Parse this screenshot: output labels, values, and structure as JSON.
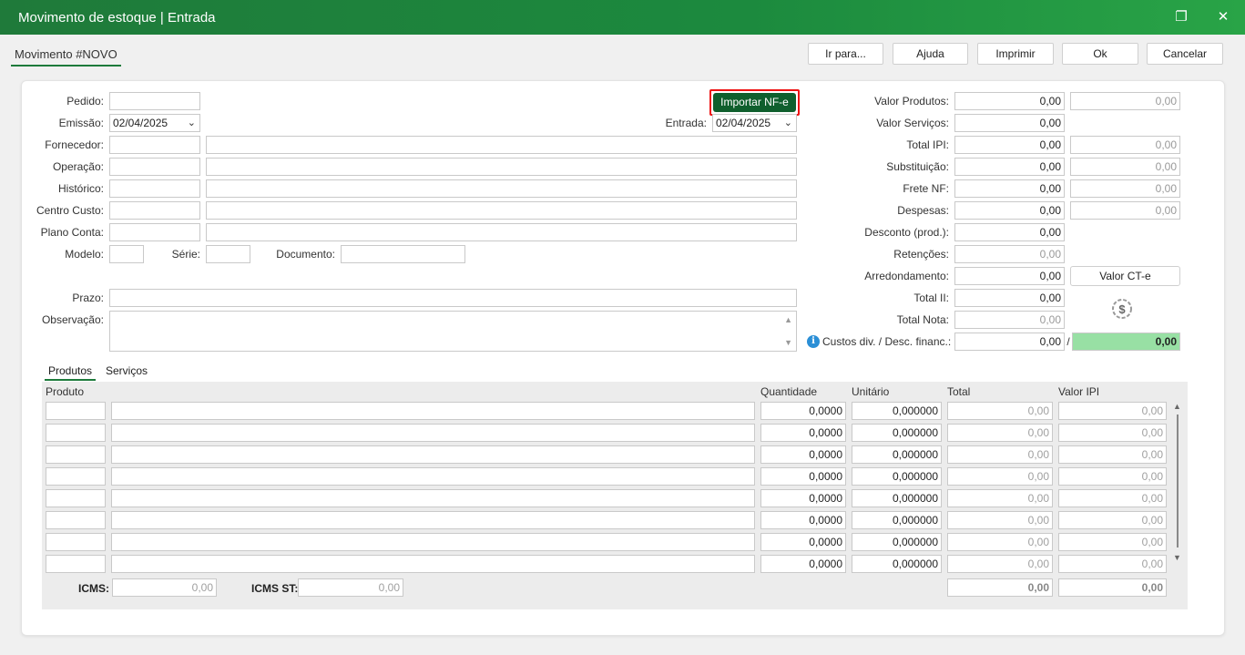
{
  "window": {
    "title": "Movimento de estoque | Entrada",
    "restore_icon": "restore-icon",
    "close_icon": "close-icon"
  },
  "tab_title": "Movimento #NOVO",
  "toolbar": {
    "goto": "Ir para...",
    "help": "Ajuda",
    "print": "Imprimir",
    "ok": "Ok",
    "cancel": "Cancelar"
  },
  "form": {
    "pedido_label": "Pedido:",
    "pedido_value": "",
    "emissao_label": "Emissão:",
    "emissao_value": "02/04/2025",
    "entrada_label": "Entrada:",
    "entrada_value": "02/04/2025",
    "import_button": "Importar NF-e",
    "fornecedor_label": "Fornecedor:",
    "operacao_label": "Operação:",
    "historico_label": "Histórico:",
    "centro_custo_label": "Centro Custo:",
    "plano_conta_label": "Plano Conta:",
    "modelo_label": "Modelo:",
    "serie_label": "Série:",
    "documento_label": "Documento:",
    "prazo_label": "Prazo:",
    "observacao_label": "Observação:"
  },
  "totals": {
    "valor_produtos_label": "Valor Produtos:",
    "valor_produtos": "0,00",
    "valor_produtos_2": "0,00",
    "valor_servicos_label": "Valor Serviços:",
    "valor_servicos": "0,00",
    "total_ipi_label": "Total IPI:",
    "total_ipi": "0,00",
    "total_ipi_2": "0,00",
    "substituicao_label": "Substituição:",
    "substituicao": "0,00",
    "substituicao_2": "0,00",
    "frete_label": "Frete NF:",
    "frete": "0,00",
    "frete_2": "0,00",
    "despesas_label": "Despesas:",
    "despesas": "0,00",
    "despesas_2": "0,00",
    "desconto_label": "Desconto (prod.):",
    "desconto": "0,00",
    "retencoes_label": "Retenções:",
    "retencoes": "0,00",
    "arredondamento_label": "Arredondamento:",
    "arredondamento": "0,00",
    "valor_cte_button": "Valor CT-e",
    "total_ii_label": "Total II:",
    "total_ii": "0,00",
    "total_nota_label": "Total Nota:",
    "total_nota": "0,00",
    "custos_label": "Custos div. / Desc. financ.:",
    "custos": "0,00",
    "custos_sep": "/",
    "custos_2": "0,00"
  },
  "subtabs": {
    "produtos": "Produtos",
    "servicos": "Serviços"
  },
  "grid": {
    "headers": {
      "produto": "Produto",
      "quantidade": "Quantidade",
      "unitario": "Unitário",
      "total": "Total",
      "valor_ipi": "Valor IPI"
    },
    "rows": [
      {
        "quantidade": "0,0000",
        "unitario": "0,000000",
        "total": "0,00",
        "valor_ipi": "0,00"
      },
      {
        "quantidade": "0,0000",
        "unitario": "0,000000",
        "total": "0,00",
        "valor_ipi": "0,00"
      },
      {
        "quantidade": "0,0000",
        "unitario": "0,000000",
        "total": "0,00",
        "valor_ipi": "0,00"
      },
      {
        "quantidade": "0,0000",
        "unitario": "0,000000",
        "total": "0,00",
        "valor_ipi": "0,00"
      },
      {
        "quantidade": "0,0000",
        "unitario": "0,000000",
        "total": "0,00",
        "valor_ipi": "0,00"
      },
      {
        "quantidade": "0,0000",
        "unitario": "0,000000",
        "total": "0,00",
        "valor_ipi": "0,00"
      },
      {
        "quantidade": "0,0000",
        "unitario": "0,000000",
        "total": "0,00",
        "valor_ipi": "0,00"
      },
      {
        "quantidade": "0,0000",
        "unitario": "0,000000",
        "total": "0,00",
        "valor_ipi": "0,00"
      }
    ],
    "footer": {
      "icms_label": "ICMS:",
      "icms": "0,00",
      "icms_st_label": "ICMS ST:",
      "icms_st": "0,00",
      "total_sum": "0,00",
      "ipi_sum": "0,00"
    }
  },
  "colors": {
    "titlebar": "#1c8a3e",
    "import_button": "#0f5f2d",
    "highlight": "#e11111",
    "custos_green": "#98e0a4"
  }
}
